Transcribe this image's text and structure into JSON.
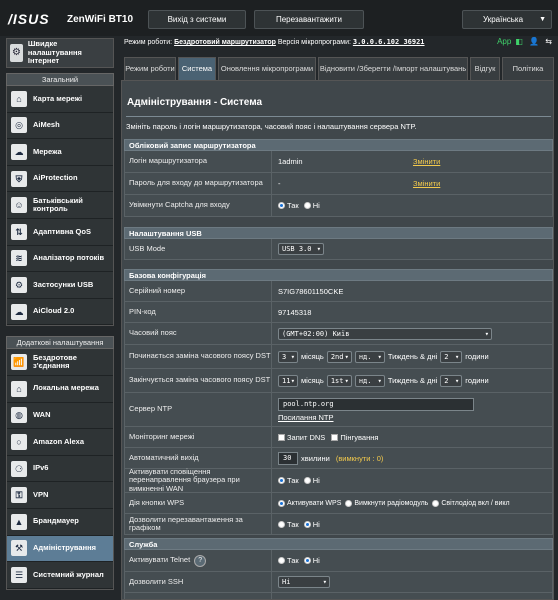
{
  "header": {
    "brand": "/ISUS",
    "model": "ZenWiFi BT10",
    "logout_label": "Вихід з системи",
    "reboot_label": "Перезавантажити",
    "language": "Українська"
  },
  "status": {
    "mode_label": "Режим роботи:",
    "mode_value": "Бездротовий маршрутизатор",
    "fw_label": "Версія мікропрограми:",
    "fw_value": "3.0.0.6.102_36921",
    "app_label": "App"
  },
  "sidebar": {
    "quick_setup": "Швидке налаштування Інтернет",
    "general_header": "Загальний",
    "general_items": [
      {
        "label": "Карта мережі",
        "icon": "network-map-icon"
      },
      {
        "label": "AiMesh",
        "icon": "aimesh-icon"
      },
      {
        "label": "Мережа",
        "icon": "guest-network-icon"
      },
      {
        "label": "AiProtection",
        "icon": "aiprotection-icon"
      },
      {
        "label": "Батьківський контроль",
        "icon": "parental-control-icon"
      },
      {
        "label": "Адаптивна QoS",
        "icon": "qos-icon"
      },
      {
        "label": "Аналізатор потоків",
        "icon": "traffic-analyzer-icon"
      },
      {
        "label": "Застосунки USB",
        "icon": "usb-icon"
      },
      {
        "label": "AiCloud 2.0",
        "icon": "aicloud-icon"
      }
    ],
    "advanced_header": "Додаткові налаштування",
    "advanced_items": [
      {
        "label": "Бездротове з'єднання",
        "icon": "wireless-icon"
      },
      {
        "label": "Локальна мережа",
        "icon": "lan-icon"
      },
      {
        "label": "WAN",
        "icon": "wan-icon"
      },
      {
        "label": "Amazon Alexa",
        "icon": "alexa-icon"
      },
      {
        "label": "IPv6",
        "icon": "ipv6-icon"
      },
      {
        "label": "VPN",
        "icon": "vpn-icon"
      },
      {
        "label": "Брандмауер",
        "icon": "firewall-icon"
      },
      {
        "label": "Адміністрування",
        "icon": "administration-icon"
      },
      {
        "label": "Системний журнал",
        "icon": "system-log-icon"
      }
    ]
  },
  "tabs": [
    "Режим роботи",
    "Система",
    "Оновлення мікропрограми",
    "Відновити /Зберегти /Імпорт налаштувань",
    "Відгук",
    "Політика"
  ],
  "page": {
    "title": "Адміністрування - Система",
    "description": "Змініть пароль і логін маршрутизатора, часовий пояс і налаштування сервера NTP."
  },
  "account": {
    "header": "Обліковий запис маршрутизатора",
    "login_label": "Логін маршрутизатора",
    "login_value": "1admin",
    "password_label": "Пароль для входу до маршрутизатора",
    "password_value": "-",
    "change_label": "Змінити",
    "captcha_label": "Увімкнути Captcha для входу",
    "yes": "Так",
    "no": "Ні"
  },
  "usb": {
    "header": "Налаштування USB",
    "mode_label": "USB Mode",
    "mode_value": "USB 3.0"
  },
  "basic": {
    "header": "Базова конфігурація",
    "serial_label": "Серійний номер",
    "serial_value": "S7IG78601150CKE",
    "pin_label": "PIN-код",
    "pin_value": "97145318",
    "tz_label": "Часовий пояс",
    "tz_value": "(GMT+02:00) Київ",
    "dst_start_label": "Починається заміна часового поясу DST",
    "dst_end_label": "Закінчується заміна часового поясу DST",
    "dst_start": {
      "month": "3",
      "week": "2nd",
      "day": "нд.",
      "hour": "2"
    },
    "dst_end": {
      "month": "11",
      "week": "1st",
      "day": "нд.",
      "hour": "2"
    },
    "month_word": "місяць",
    "week_word": "Тиждень & дні",
    "hours_word": "години",
    "ntp_label": "Сервер NTP",
    "ntp_value": "pool.ntp.org",
    "ntp_link": "Посилання NTP",
    "monitor_label": "Моніторинг мережі",
    "dns_query": "Запит DNS",
    "ping": "Пінгування",
    "logout_label": "Автоматичний вихід",
    "logout_value": "30",
    "logout_unit": "хвилини",
    "logout_hint": "(вимкнути : 0)",
    "redirect_label": "Активувати сповіщення перенаправлення браузера при вимкненні WAN",
    "wps_label": "Дія кнопки WPS",
    "wps_opt1": "Активувати WPS",
    "wps_opt2": "Вимкнути радіомодуль",
    "wps_opt3": "Світлодіод вкл / викл",
    "reboot_sched_label": "Дозволити перезавантаження за графіком"
  },
  "service": {
    "header": "Служба",
    "telnet_label": "Активувати Telnet",
    "ssh_label": "Дозволити SSH",
    "ssh_value": "Ні"
  }
}
